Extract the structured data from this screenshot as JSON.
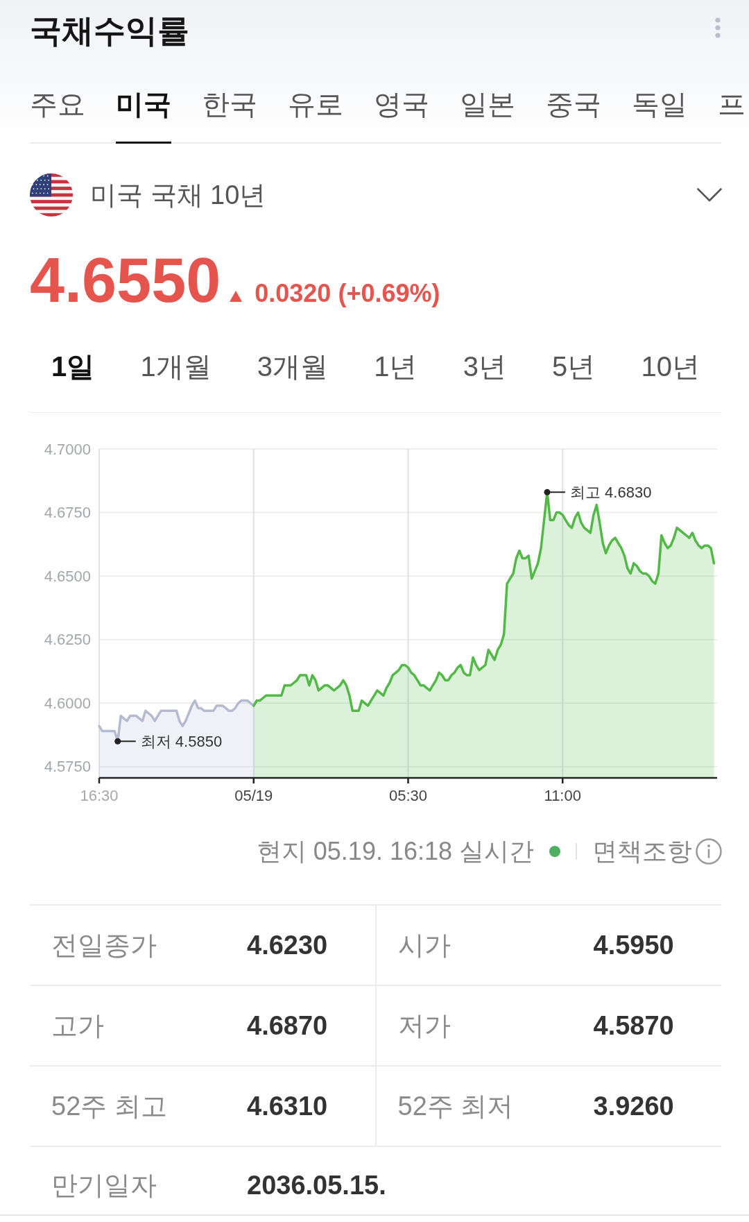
{
  "header": {
    "title": "국채수익률"
  },
  "country_tabs": [
    {
      "label": "주요",
      "selected": false
    },
    {
      "label": "미국",
      "selected": true
    },
    {
      "label": "한국",
      "selected": false
    },
    {
      "label": "유로",
      "selected": false
    },
    {
      "label": "영국",
      "selected": false
    },
    {
      "label": "일본",
      "selected": false
    },
    {
      "label": "중국",
      "selected": false
    },
    {
      "label": "독일",
      "selected": false
    },
    {
      "label": "프",
      "selected": false
    }
  ],
  "instrument": {
    "name": "미국 국채 10년"
  },
  "quote": {
    "price": "4.6550",
    "up": true,
    "change": "0.0320 (+0.69%)"
  },
  "period_tabs": [
    {
      "label": "1일",
      "selected": true
    },
    {
      "label": "1개월",
      "selected": false
    },
    {
      "label": "3개월",
      "selected": false
    },
    {
      "label": "1년",
      "selected": false
    },
    {
      "label": "3년",
      "selected": false
    },
    {
      "label": "5년",
      "selected": false
    },
    {
      "label": "10년",
      "selected": false
    }
  ],
  "chart": {
    "chart_data": {
      "type": "area",
      "grid": true,
      "categories": [
        "16:30",
        null,
        null,
        null,
        null,
        null,
        null,
        null,
        null,
        null,
        null,
        null,
        null,
        null,
        null,
        null,
        null,
        null,
        null,
        null,
        null,
        null,
        null,
        null,
        null,
        null,
        null,
        null,
        null,
        null,
        null,
        null,
        null,
        null,
        null,
        null,
        null,
        null,
        null,
        null,
        null,
        null,
        null,
        null,
        null,
        null,
        null,
        null,
        null,
        null,
        "05/19",
        null,
        null,
        null,
        null,
        null,
        null,
        null,
        null,
        null,
        null,
        null,
        null,
        null,
        null,
        null,
        null,
        null,
        null,
        null,
        null,
        null,
        null,
        null,
        null,
        null,
        null,
        null,
        null,
        null,
        null,
        null,
        null,
        null,
        null,
        null,
        null,
        null,
        null,
        null,
        null,
        null,
        null,
        null,
        null,
        null,
        null,
        null,
        null,
        null,
        "05:30",
        null,
        null,
        null,
        null,
        null,
        null,
        null,
        null,
        null,
        null,
        null,
        null,
        null,
        null,
        null,
        null,
        null,
        null,
        null,
        null,
        null,
        null,
        null,
        null,
        null,
        null,
        null,
        null,
        null,
        null,
        null,
        null,
        null,
        null,
        null,
        null,
        null,
        null,
        null,
        null,
        null,
        null,
        null,
        null,
        null,
        null,
        null,
        null,
        null,
        "11:00",
        null,
        null,
        null,
        null,
        null,
        null,
        null,
        null,
        null,
        null,
        null,
        null,
        null,
        null,
        null,
        null,
        null,
        null,
        null,
        null,
        null,
        null,
        null,
        null,
        null,
        null,
        null,
        null,
        null,
        null,
        null,
        null,
        null,
        null,
        null,
        null,
        null,
        null,
        null,
        null,
        null,
        null,
        null,
        null,
        null,
        null,
        null,
        null,
        null
      ],
      "ylim": [
        4.5706,
        4.7
      ],
      "yticks": [
        {
          "value": 4.575,
          "label": "4.5750"
        },
        {
          "value": 4.6,
          "label": "4.6000"
        },
        {
          "value": 4.625,
          "label": "4.6250"
        },
        {
          "value": 4.65,
          "label": "4.6500"
        },
        {
          "value": 4.675,
          "label": "4.6750"
        },
        {
          "value": 4.7,
          "label": "4.7000"
        }
      ],
      "series": [
        {
          "color": "#b4bbd1",
          "values": [
            4.591,
            4.589,
            4.589,
            4.589,
            4.589,
            4.589,
            4.585,
            4.595,
            4.594,
            4.593,
            4.595,
            4.595,
            4.595,
            4.594,
            4.593,
            4.597,
            4.596,
            4.595,
            4.593,
            4.595,
            4.597,
            4.597,
            4.597,
            4.597,
            4.597,
            4.597,
            4.593,
            4.591,
            4.593,
            4.596,
            4.599,
            4.601,
            4.598,
            4.598,
            4.597,
            4.597,
            4.597,
            4.597,
            4.599,
            4.599,
            4.599,
            4.598,
            4.597,
            4.597,
            4.598,
            4.6,
            4.601,
            4.601,
            4.601,
            4.6,
            4.599,
            null,
            null,
            null,
            null,
            null,
            null,
            null,
            null,
            null,
            null,
            null,
            null,
            null,
            null,
            null,
            null,
            null,
            null,
            null,
            null,
            null,
            null,
            null,
            null,
            null,
            null,
            null,
            null,
            null,
            null,
            null,
            null,
            null,
            null,
            null,
            null,
            null,
            null,
            null,
            null,
            null,
            null,
            null,
            null,
            null,
            null,
            null,
            null,
            null,
            null,
            null,
            null,
            null,
            null,
            null,
            null,
            null,
            null,
            null,
            null,
            null,
            null,
            null,
            null,
            null,
            null,
            null,
            null,
            null,
            null,
            null,
            null,
            null,
            null,
            null,
            null,
            null,
            null,
            null,
            null,
            null,
            null,
            null,
            null,
            null,
            null,
            null,
            null,
            null,
            null,
            null,
            null,
            null,
            null,
            null,
            null,
            null,
            null,
            null,
            null,
            null,
            null,
            null,
            null,
            null,
            null,
            null,
            null,
            null,
            null,
            null,
            null,
            null,
            null,
            null,
            null,
            null,
            null,
            null,
            null,
            null,
            null,
            null,
            null,
            null,
            null,
            null,
            null,
            null,
            null,
            null,
            null,
            null,
            null,
            null,
            null,
            null,
            null,
            null,
            null,
            null,
            null,
            null,
            null,
            null,
            null,
            null,
            null,
            null
          ]
        },
        {
          "color": "#52b947",
          "values": [
            null,
            null,
            null,
            null,
            null,
            null,
            null,
            null,
            null,
            null,
            null,
            null,
            null,
            null,
            null,
            null,
            null,
            null,
            null,
            null,
            null,
            null,
            null,
            null,
            null,
            null,
            null,
            null,
            null,
            null,
            null,
            null,
            null,
            null,
            null,
            null,
            null,
            null,
            null,
            null,
            null,
            null,
            null,
            null,
            null,
            null,
            null,
            null,
            null,
            null,
            4.599,
            4.601,
            4.601,
            4.602,
            4.603,
            4.603,
            4.603,
            4.603,
            4.603,
            4.603,
            4.607,
            4.607,
            4.607,
            4.608,
            4.609,
            4.611,
            4.611,
            4.611,
            4.607,
            4.611,
            4.609,
            4.605,
            4.606,
            4.607,
            4.607,
            4.606,
            4.605,
            4.606,
            4.607,
            4.609,
            4.607,
            4.603,
            4.597,
            4.597,
            4.597,
            4.601,
            4.6,
            4.599,
            4.601,
            4.603,
            4.605,
            4.604,
            4.603,
            4.606,
            4.608,
            4.611,
            4.612,
            4.613,
            4.615,
            4.615,
            4.614,
            4.612,
            4.611,
            4.609,
            4.607,
            4.607,
            4.606,
            4.605,
            4.607,
            4.609,
            4.612,
            4.611,
            4.609,
            4.609,
            4.611,
            4.612,
            4.614,
            4.615,
            4.612,
            4.611,
            4.611,
            4.618,
            4.615,
            4.613,
            4.614,
            4.615,
            4.621,
            4.619,
            4.617,
            4.621,
            4.623,
            4.627,
            4.647,
            4.649,
            4.651,
            4.657,
            4.66,
            4.657,
            4.657,
            4.658,
            4.649,
            4.652,
            4.655,
            4.661,
            4.672,
            4.683,
            4.672,
            4.672,
            4.675,
            4.675,
            4.674,
            4.672,
            4.67,
            4.669,
            4.673,
            4.675,
            4.671,
            4.669,
            4.668,
            4.667,
            4.674,
            4.678,
            4.671,
            4.663,
            4.659,
            4.662,
            4.664,
            4.665,
            4.663,
            4.661,
            4.658,
            4.653,
            4.651,
            4.655,
            4.654,
            4.652,
            4.651,
            4.651,
            4.65,
            4.648,
            4.647,
            4.651,
            4.666,
            4.663,
            4.661,
            4.662,
            4.665,
            4.669,
            4.668,
            4.667,
            4.666,
            4.665,
            4.667,
            4.664,
            4.662,
            4.661,
            4.662,
            4.662,
            4.661,
            4.655
          ]
        }
      ],
      "annotations": [
        "최저 4.5850",
        "최고 4.6830"
      ]
    }
  },
  "status": {
    "time": "현지 05.19. 16:18 실시간",
    "disclaimer": "면책조항"
  },
  "stats": [
    {
      "cells": [
        {
          "label": "전일종가",
          "value": "4.6230"
        },
        {
          "label": "시가",
          "value": "4.5950"
        }
      ]
    },
    {
      "cells": [
        {
          "label": "고가",
          "value": "4.6870"
        },
        {
          "label": "저가",
          "value": "4.5870"
        }
      ]
    },
    {
      "cells": [
        {
          "label": "52주 최고",
          "value": "4.6310"
        },
        {
          "label": "52주 최저",
          "value": "3.9260"
        }
      ]
    },
    {
      "cells": [
        {
          "label": "만기일자",
          "value": "2036.05.15."
        }
      ]
    }
  ]
}
